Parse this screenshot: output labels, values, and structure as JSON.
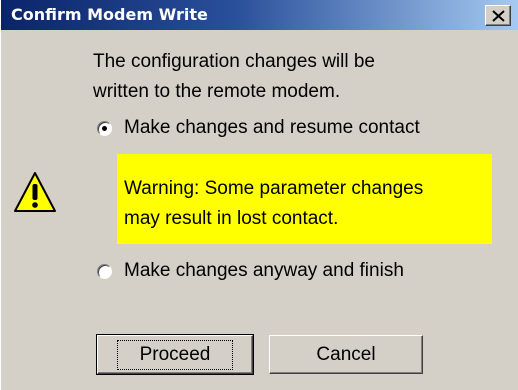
{
  "dialog": {
    "title": "Confirm Modem Write",
    "close_label": "×"
  },
  "message": {
    "line1": "The configuration changes will be",
    "line2": "written to the remote modem."
  },
  "options": [
    {
      "label": "Make changes and resume contact",
      "selected": true
    },
    {
      "label": "Make changes anyway and finish",
      "selected": false
    }
  ],
  "warning": {
    "line1": "Warning: Some parameter changes",
    "line2": "may result in lost contact.",
    "background": "#ffff00"
  },
  "buttons": {
    "proceed": "Proceed",
    "cancel": "Cancel"
  },
  "icons": {
    "close": "close-icon",
    "warning": "warning-triangle-icon"
  },
  "colors": {
    "title_bar_start": "#0a246a",
    "title_bar_end": "#a6caf0",
    "dialog_bg": "#d4d0c8"
  }
}
